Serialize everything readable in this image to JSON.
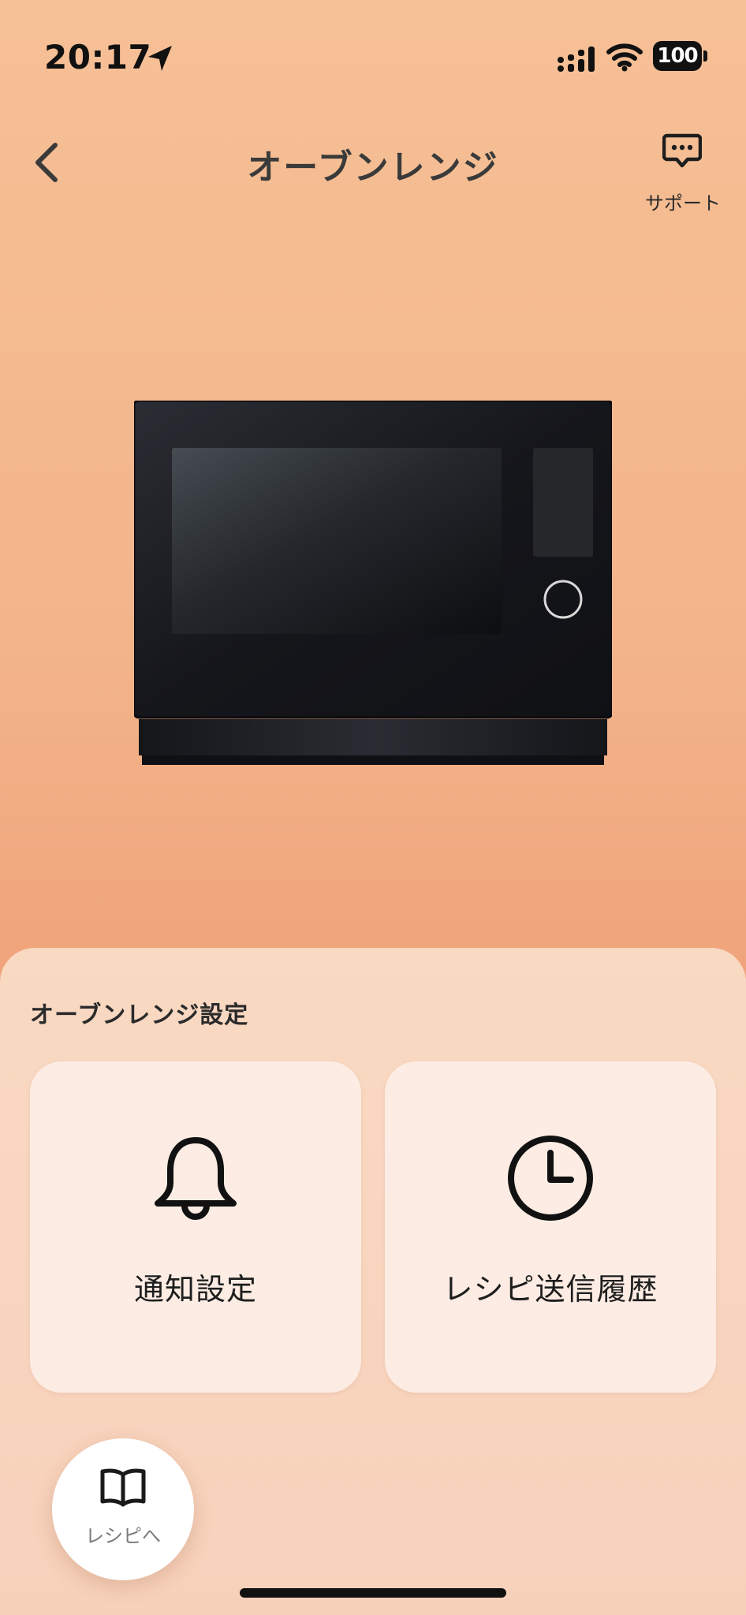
{
  "status_bar": {
    "time": "20:17",
    "battery": "100"
  },
  "header": {
    "title": "オーブンレンジ",
    "support_label": "サポート"
  },
  "settings": {
    "section_title": "オーブンレンジ設定",
    "cards": [
      {
        "label": "通知設定",
        "icon": "bell-icon"
      },
      {
        "label": "レシピ送信履歴",
        "icon": "clock-icon"
      }
    ]
  },
  "recipe_button": {
    "label": "レシピへ",
    "icon": "book-icon"
  },
  "colors": {
    "background_top": "#f6c096",
    "background_mid": "#f0a47b",
    "sheet": "#f9d9c2",
    "card": "#fcece3",
    "oven_body": "#15161b"
  }
}
